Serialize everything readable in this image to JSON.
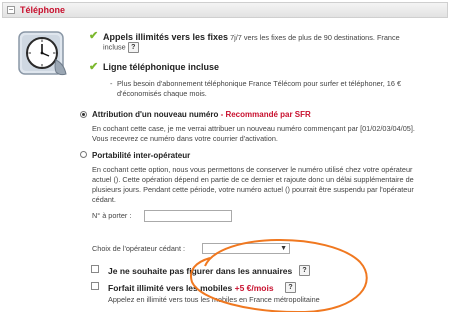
{
  "header": {
    "title": "Téléphone",
    "collapse_glyph": "−"
  },
  "features": [
    {
      "icon": "check-icon",
      "title": "Appels illimités vers les fixes",
      "desc_line1": " 7j/7 vers les fixes de plus de 90 destinations. France",
      "desc_line2": "incluse"
    },
    {
      "icon": "check-icon",
      "title": "Ligne téléphonique incluse"
    }
  ],
  "note_lines": [
    "Plus besoin d'abonnement téléphonique France Télécom pour surfer et téléphoner, 16 €",
    "d'économisés chaque mois."
  ],
  "option_new_number": {
    "selected": true,
    "label": "Attribution d'un nouveau numéro",
    "recommend": " - Recommandé par SFR",
    "desc_line1": "En cochant cette case, je me verrai attribuer un nouveau numéro commençant par [01/02/03/04/05].",
    "desc_line2": "Vous recevrez ce numéro dans votre courrier d'activation."
  },
  "option_portability": {
    "selected": false,
    "label": "Portabilité inter-opérateur",
    "desc_lines": [
      "En cochant cette option, nous vous permettons de conserver le numéro utilisé chez votre opérateur",
      "actuel (). Cette opération dépend en partie de ce dernier et rajoute donc un délai supplémentaire de",
      "plusieurs jours. Pendant cette période, votre numéro actuel () pourrait être suspendu par l'opérateur",
      "cédant."
    ]
  },
  "port_number": {
    "label": "N° à porter :",
    "value": ""
  },
  "operator": {
    "label": "Choix de l'opérateur cédant :",
    "value": ""
  },
  "directory": {
    "checked": false,
    "label": "Je ne souhaite pas figurer dans les annuaires"
  },
  "mobile_plan": {
    "checked": false,
    "label": "Forfait illimité vers les mobiles ",
    "price": "+5 €/mois",
    "desc": "Appelez en illimité vers tous les mobiles en France métropolitaine"
  },
  "help_glyph": "?",
  "annotation_color": "#f07820"
}
